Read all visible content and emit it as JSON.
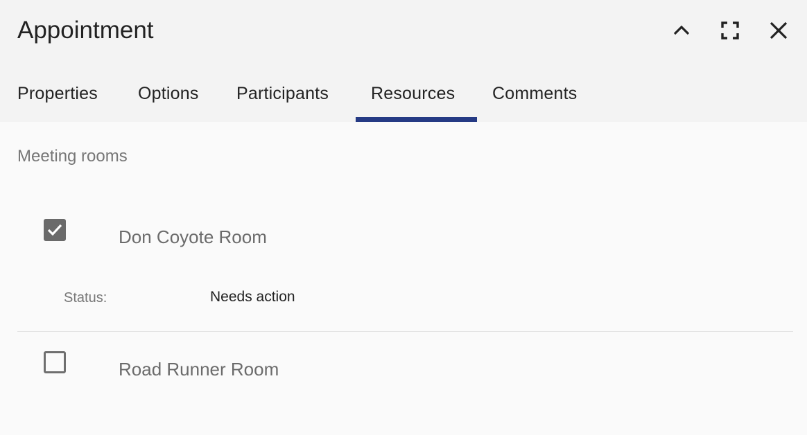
{
  "dialog": {
    "title": "Appointment",
    "controls": {
      "collapse_icon": "chevron-up-icon",
      "maximize_icon": "maximize-icon",
      "close_icon": "close-icon"
    }
  },
  "tabs": [
    {
      "label": "Properties",
      "active": false
    },
    {
      "label": "Options",
      "active": false
    },
    {
      "label": "Participants",
      "active": false
    },
    {
      "label": "Resources",
      "active": true
    },
    {
      "label": "Comments",
      "active": false
    }
  ],
  "colors": {
    "header_bg": "#f3f3f3",
    "body_bg": "#fafafa",
    "active_tab_indicator": "#253a84",
    "checkbox": "#6a6a6a"
  },
  "resources": {
    "section_label": "Meeting rooms",
    "items": [
      {
        "name": "Don Coyote Room",
        "checked": true,
        "status_label": "Status:",
        "status_value": "Needs action"
      },
      {
        "name": "Road Runner Room",
        "checked": false
      }
    ]
  }
}
